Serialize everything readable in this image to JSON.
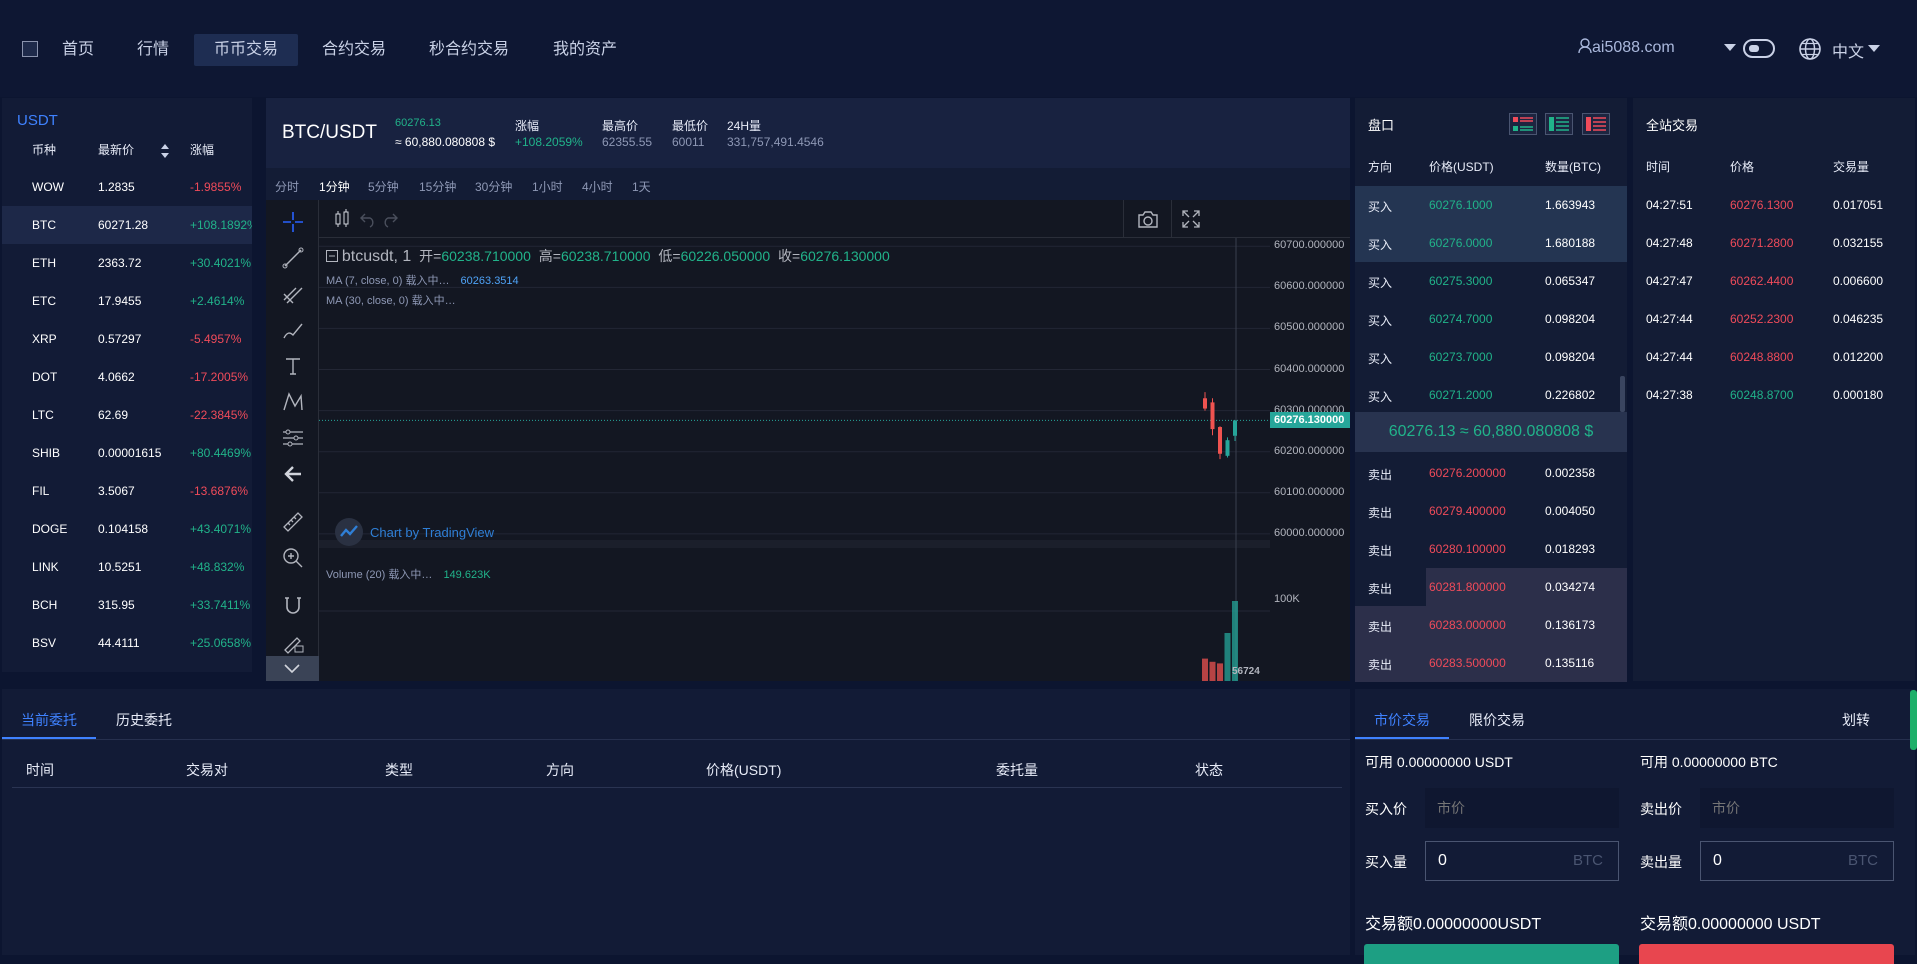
{
  "nav": {
    "items": [
      "首页",
      "行情",
      "币币交易",
      "合约交易",
      "秒合约交易",
      "我的资产"
    ],
    "user": "ai5088.com",
    "language": "中文"
  },
  "market": {
    "title": "USDT",
    "headers": [
      "币种",
      "最新价",
      "涨幅"
    ],
    "rows": [
      {
        "coin": "WOW",
        "price": "1.2835",
        "change": "-1.9855%",
        "dir": "down"
      },
      {
        "coin": "BTC",
        "price": "60271.28",
        "change": "+108.1892%",
        "dir": "up"
      },
      {
        "coin": "ETH",
        "price": "2363.72",
        "change": "+30.4021%",
        "dir": "up"
      },
      {
        "coin": "ETC",
        "price": "17.9455",
        "change": "+2.4614%",
        "dir": "up"
      },
      {
        "coin": "XRP",
        "price": "0.57297",
        "change": "-5.4957%",
        "dir": "down"
      },
      {
        "coin": "DOT",
        "price": "4.0662",
        "change": "-17.2005%",
        "dir": "down"
      },
      {
        "coin": "LTC",
        "price": "62.69",
        "change": "-22.3845%",
        "dir": "down"
      },
      {
        "coin": "SHIB",
        "price": "0.00001615",
        "change": "+80.4469%",
        "dir": "up"
      },
      {
        "coin": "FIL",
        "price": "3.5067",
        "change": "-13.6876%",
        "dir": "down"
      },
      {
        "coin": "DOGE",
        "price": "0.104158",
        "change": "+43.4071%",
        "dir": "up"
      },
      {
        "coin": "LINK",
        "price": "10.5251",
        "change": "+48.832%",
        "dir": "up"
      },
      {
        "coin": "BCH",
        "price": "315.95",
        "change": "+33.7411%",
        "dir": "up"
      },
      {
        "coin": "BSV",
        "price": "44.4111",
        "change": "+25.0658%",
        "dir": "up"
      }
    ]
  },
  "ticker": {
    "pair": "BTC/USDT",
    "last": "60276.13",
    "last_usd": "≈ 60,880.080808 $",
    "change_label": "涨幅",
    "change": "+108.2059%",
    "high_label": "最高价",
    "high": "62355.55",
    "low_label": "最低价",
    "low": "60011",
    "vol_label": "24H量",
    "vol": "331,757,491.4546"
  },
  "intervals": [
    "分时",
    "1分钟",
    "5分钟",
    "15分钟",
    "30分钟",
    "1小时",
    "4小时",
    "1天"
  ],
  "chart": {
    "legend_symbol": "btcusdt, 1",
    "open_label": "开=",
    "open": "60238.710000",
    "high_label": "高=",
    "high": "60238.710000",
    "low_label": "低=",
    "low": "60226.050000",
    "close_label": "收=",
    "close": "60276.130000",
    "ma7_label": "MA (7, close, 0) 载入中…",
    "ma7_value": "60263.3514",
    "ma30_label": "MA (30, close, 0) 载入中…",
    "brand": "Chart by TradingView",
    "volume_label": "Volume (20) 载入中…",
    "volume_value": "149.623K",
    "axis_ticks": [
      "60700.000000",
      "60600.000000",
      "60500.000000",
      "60400.000000",
      "60300.000000",
      "60200.000000",
      "60100.000000",
      "60000.000000"
    ],
    "price_tag": "60276.130000",
    "vol_axis": "100K",
    "vol_bottom": "56724"
  },
  "chart_data": {
    "type": "candlestick",
    "candles": [
      {
        "o": 60330,
        "h": 60345,
        "l": 60300,
        "c": 60305,
        "dir": "down"
      },
      {
        "o": 60320,
        "h": 60330,
        "l": 60240,
        "c": 60255,
        "dir": "down"
      },
      {
        "o": 60260,
        "h": 60262,
        "l": 60182,
        "c": 60195,
        "dir": "down"
      },
      {
        "o": 60190,
        "h": 60235,
        "l": 60186,
        "c": 60228,
        "dir": "up"
      },
      {
        "o": 60238.71,
        "h": 60238.71,
        "l": 60226.05,
        "c": 60276.13,
        "dir": "up"
      }
    ],
    "ylim": [
      59990,
      60720
    ],
    "volume_max": 149623
  },
  "book": {
    "title": "盘口",
    "headers": [
      "方向",
      "价格(USDT)",
      "数量(BTC)"
    ],
    "bids": [
      {
        "side": "买入",
        "price": "60276.1000",
        "amount": "1.663943",
        "depth": 1.0
      },
      {
        "side": "买入",
        "price": "60276.0000",
        "amount": "1.680188",
        "depth": 1.0
      },
      {
        "side": "买入",
        "price": "60275.3000",
        "amount": "0.065347",
        "depth": 0
      },
      {
        "side": "买入",
        "price": "60274.7000",
        "amount": "0.098204",
        "depth": 0
      },
      {
        "side": "买入",
        "price": "60273.7000",
        "amount": "0.098204",
        "depth": 0
      },
      {
        "side": "买入",
        "price": "60271.2000",
        "amount": "0.226802",
        "depth": 0
      }
    ],
    "mid": "60276.13 ≈ 60,880.080808 $",
    "asks": [
      {
        "side": "卖出",
        "price": "60276.200000",
        "amount": "0.002358",
        "depth": 0
      },
      {
        "side": "卖出",
        "price": "60279.400000",
        "amount": "0.004050",
        "depth": 0
      },
      {
        "side": "卖出",
        "price": "60280.100000",
        "amount": "0.018293",
        "depth": 0
      },
      {
        "side": "卖出",
        "price": "60281.800000",
        "amount": "0.034274",
        "depth": 0.74
      },
      {
        "side": "卖出",
        "price": "60283.000000",
        "amount": "0.136173",
        "depth": 1.0
      },
      {
        "side": "卖出",
        "price": "60283.500000",
        "amount": "0.135116",
        "depth": 1.0
      }
    ]
  },
  "trades": {
    "title": "全站交易",
    "headers": [
      "时间",
      "价格",
      "交易量"
    ],
    "rows": [
      {
        "time": "04:27:51",
        "price": "60276.1300",
        "amount": "0.017051",
        "dir": "down"
      },
      {
        "time": "04:27:48",
        "price": "60271.2800",
        "amount": "0.032155",
        "dir": "down"
      },
      {
        "time": "04:27:47",
        "price": "60262.4400",
        "amount": "0.006600",
        "dir": "down"
      },
      {
        "time": "04:27:44",
        "price": "60252.2300",
        "amount": "0.046235",
        "dir": "down"
      },
      {
        "time": "04:27:44",
        "price": "60248.8800",
        "amount": "0.012200",
        "dir": "down"
      },
      {
        "time": "04:27:38",
        "price": "60248.8700",
        "amount": "0.000180",
        "dir": "up"
      }
    ]
  },
  "orders": {
    "tabs": [
      "当前委托",
      "历史委托"
    ],
    "columns": [
      "时间",
      "交易对",
      "类型",
      "方向",
      "价格(USDT)",
      "委托量",
      "状态"
    ]
  },
  "form": {
    "tabs": [
      "市价交易",
      "限价交易"
    ],
    "transfer": "划转",
    "buy_avail": "可用 0.00000000 USDT",
    "sell_avail": "可用 0.00000000 BTC",
    "buy_price_label": "买入价",
    "sell_price_label": "卖出价",
    "price_placeholder": "市价",
    "buy_amount_label": "买入量",
    "sell_amount_label": "卖出量",
    "amount_value": "0",
    "unit": "BTC",
    "buy_total": "交易额0.00000000USDT",
    "sell_total": "交易额0.00000000 USDT"
  },
  "colors": {
    "up": "#21b38a",
    "down": "#f04b5a",
    "accent": "#3f82ff",
    "background": "#0c1530"
  }
}
